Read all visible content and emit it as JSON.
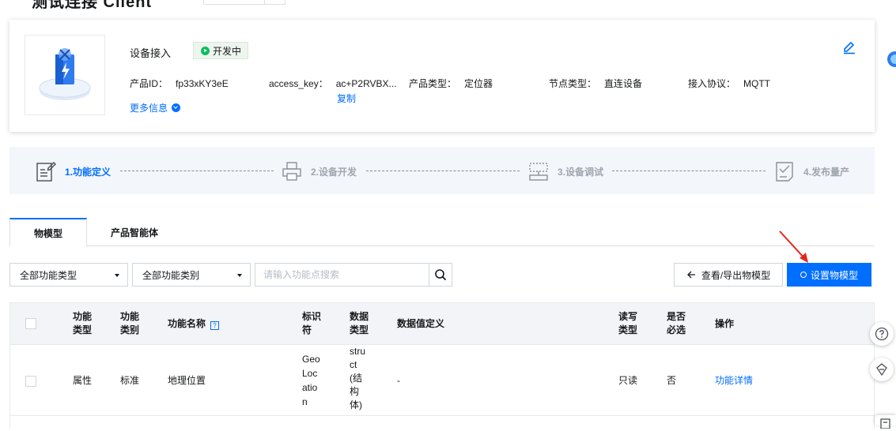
{
  "header": {
    "title": "测试连接 Client"
  },
  "product": {
    "name": "设备接入",
    "status": "开发中",
    "fields": [
      {
        "key": "产品ID：",
        "value": "fp33xKY3eE"
      },
      {
        "key": "access_key：",
        "value": "ac+P2RVBX..."
      },
      {
        "key": "产品类型：",
        "value": "定位器"
      },
      {
        "key": "节点类型：",
        "value": "直连设备"
      },
      {
        "key": "接入协议：",
        "value": "MQTT"
      }
    ],
    "copy_label": "复制",
    "more_label": "更多信息"
  },
  "steps": [
    {
      "label": "1.功能定义",
      "icon": "doc-edit-icon",
      "active": true
    },
    {
      "label": "2.设备开发",
      "icon": "printer-icon",
      "active": false
    },
    {
      "label": "3.设备调试",
      "icon": "debug-icon",
      "active": false
    },
    {
      "label": "4.发布量产",
      "icon": "checklist-icon",
      "active": false
    }
  ],
  "tabs": [
    {
      "label": "物模型",
      "active": true
    },
    {
      "label": "产品智能体",
      "active": false
    }
  ],
  "toolbar": {
    "filter_type": "全部功能类型",
    "filter_category": "全部功能类别",
    "search_placeholder": "请输入功能点搜索",
    "export_label": "查看/导出物模型",
    "set_label": "设置物模型"
  },
  "table": {
    "headers": {
      "type": [
        "功能",
        "类型"
      ],
      "category": [
        "功能",
        "类别"
      ],
      "name": "功能名称",
      "identifier": [
        "标识",
        "符"
      ],
      "datatype": [
        "数据",
        "类型"
      ],
      "definition": "数据值定义",
      "rw": [
        "读写",
        "类型"
      ],
      "required": [
        "是否",
        "必选"
      ],
      "action": "操作"
    },
    "rows": [
      {
        "type": "属性",
        "category": "标准",
        "name": "地理位置",
        "identifier": [
          "Geo",
          "Loc",
          "atio",
          "n"
        ],
        "datatype": [
          "stru",
          "ct",
          "(结",
          "构",
          "体)"
        ],
        "definition": "-",
        "rw": "只读",
        "required": "否",
        "action": "功能详情"
      }
    ]
  },
  "colors": {
    "accent": "#006eff",
    "status_green": "#0abf5b",
    "arrow_red": "#e6251c"
  }
}
